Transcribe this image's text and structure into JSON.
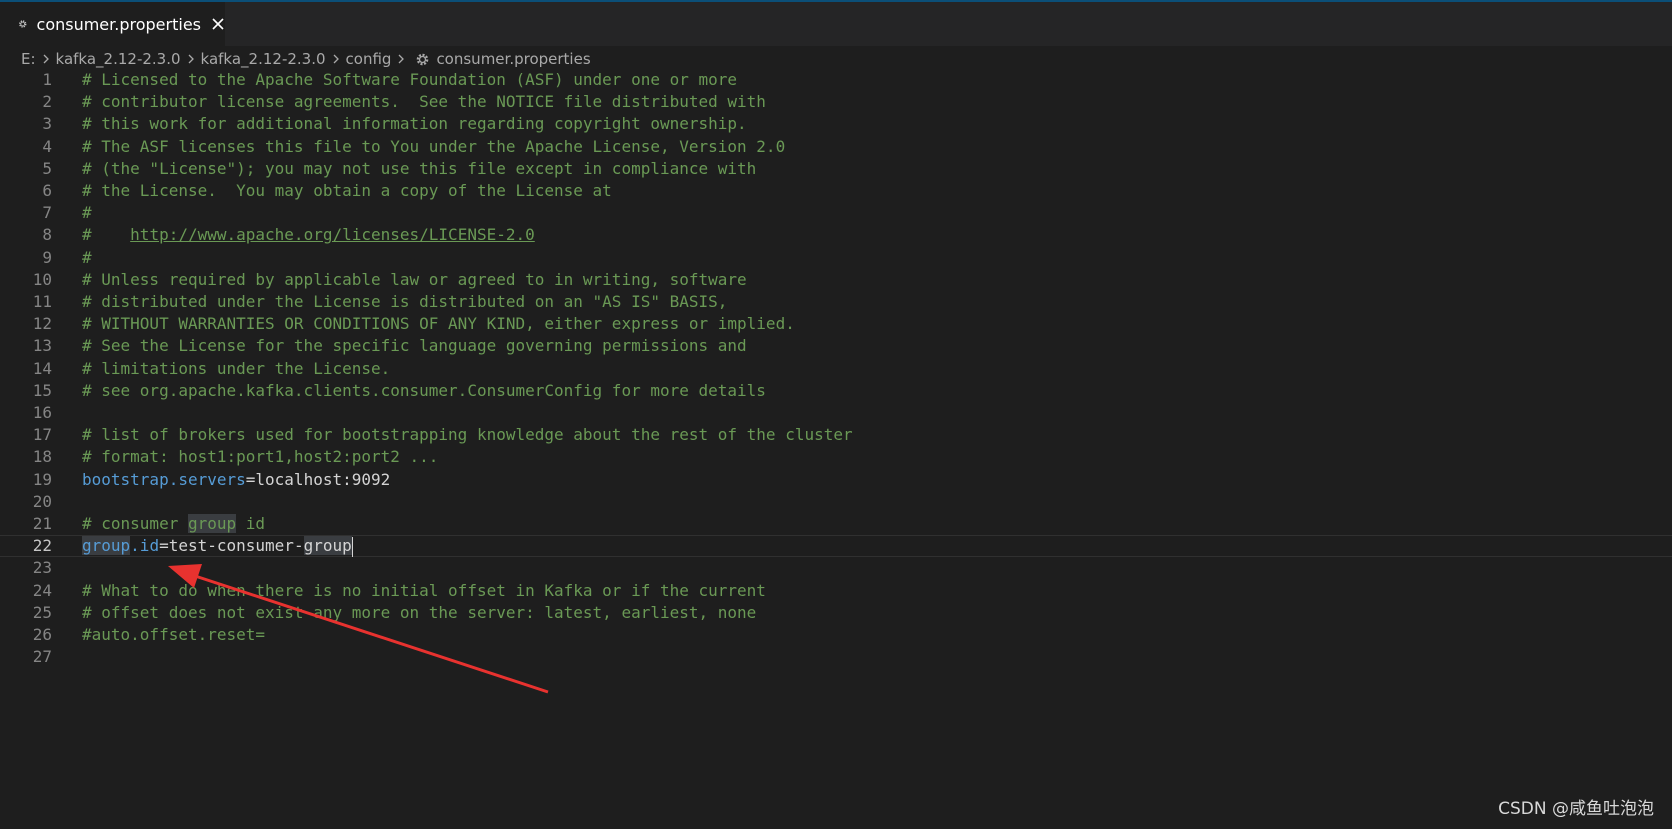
{
  "tab": {
    "title": "consumer.properties",
    "icon": "gear-icon",
    "close_icon": "close-icon"
  },
  "breadcrumb": {
    "items": [
      "E:",
      "kafka_2.12-2.3.0",
      "kafka_2.12-2.3.0",
      "config",
      "consumer.properties"
    ]
  },
  "editor": {
    "active_line": 22,
    "lines": [
      {
        "n": "1",
        "text": "# Licensed to the Apache Software Foundation (ASF) under one or more"
      },
      {
        "n": "2",
        "text": "# contributor license agreements.  See the NOTICE file distributed with"
      },
      {
        "n": "3",
        "text": "# this work for additional information regarding copyright ownership."
      },
      {
        "n": "4",
        "text": "# The ASF licenses this file to You under the Apache License, Version 2.0"
      },
      {
        "n": "5",
        "text": "# (the \"License\"); you may not use this file except in compliance with"
      },
      {
        "n": "6",
        "text": "# the License.  You may obtain a copy of the License at"
      },
      {
        "n": "7",
        "text": "#"
      },
      {
        "n": "8",
        "text_prefix": "#    ",
        "link": "http://www.apache.org/licenses/LICENSE-2.0"
      },
      {
        "n": "9",
        "text": "#"
      },
      {
        "n": "10",
        "text": "# Unless required by applicable law or agreed to in writing, software"
      },
      {
        "n": "11",
        "text": "# distributed under the License is distributed on an \"AS IS\" BASIS,"
      },
      {
        "n": "12",
        "text": "# WITHOUT WARRANTIES OR CONDITIONS OF ANY KIND, either express or implied."
      },
      {
        "n": "13",
        "text": "# See the License for the specific language governing permissions and"
      },
      {
        "n": "14",
        "text": "# limitations under the License."
      },
      {
        "n": "15",
        "text": "# see org.apache.kafka.clients.consumer.ConsumerConfig for more details"
      },
      {
        "n": "16",
        "text": ""
      },
      {
        "n": "17",
        "text": "# list of brokers used for bootstrapping knowledge about the rest of the cluster"
      },
      {
        "n": "18",
        "text": "# format: host1:port1,host2:port2 ..."
      },
      {
        "n": "19",
        "key": "bootstrap.servers",
        "value": "=localhost:9092"
      },
      {
        "n": "20",
        "text": ""
      },
      {
        "n": "21",
        "comment_prefix": "# consumer ",
        "comment_hl": "group",
        "comment_suffix": " id"
      },
      {
        "n": "22",
        "key_hl": "group",
        "key_rest": ".id",
        "value_prefix": "=test-consumer-",
        "value_hl": "group"
      },
      {
        "n": "23",
        "text": ""
      },
      {
        "n": "24",
        "text": "# What to do when there is no initial offset in Kafka or if the current"
      },
      {
        "n": "25",
        "text": "# offset does not exist any more on the server: latest, earliest, none"
      },
      {
        "n": "26",
        "text": "#auto.offset.reset="
      },
      {
        "n": "27",
        "text": ""
      }
    ]
  },
  "annotation": {
    "arrow_color": "#e8322f"
  },
  "watermark": "CSDN @咸鱼吐泡泡",
  "colors": {
    "background": "#1e1e1e",
    "comment": "#6a9955",
    "key": "#569cd6",
    "text": "#d4d4d4",
    "line_number": "#858585"
  }
}
